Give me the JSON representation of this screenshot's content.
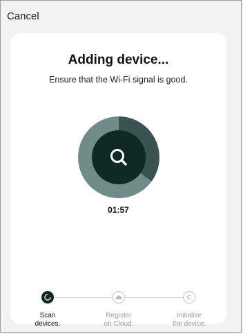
{
  "header": {
    "cancel_label": "Cancel"
  },
  "main": {
    "title": "Adding device...",
    "subtitle": "Ensure that the Wi-Fi signal is good.",
    "timer": "01:57"
  },
  "steps": [
    {
      "line1": "Scan",
      "line2": "devices.",
      "state": "active",
      "icon": "spinner-icon"
    },
    {
      "line1": "Register",
      "line2": "on Cloud.",
      "state": "pending",
      "icon": "cloud-icon"
    },
    {
      "line1": "Initialize",
      "line2": "the device.",
      "state": "pending",
      "icon": "c-circle-icon"
    }
  ],
  "colors": {
    "dark": "#0f2926",
    "ring_track": "#6f8c89",
    "ring_progress": "#3b5350",
    "muted_text": "#9a9a9a"
  },
  "progress": 0.35
}
